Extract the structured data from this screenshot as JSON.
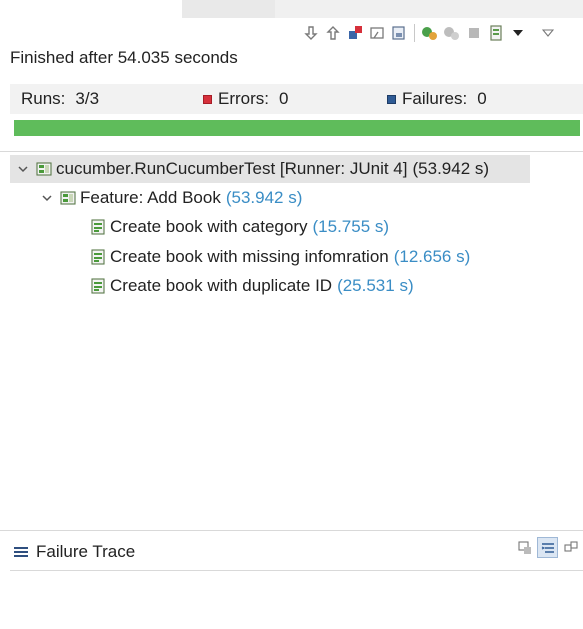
{
  "status": {
    "text": "Finished after 54.035 seconds"
  },
  "counters": {
    "runs_label": "Runs:",
    "runs_value": "3/3",
    "errors_label": "Errors:",
    "errors_value": "0",
    "failures_label": "Failures:",
    "failures_value": "0"
  },
  "progress": {
    "fraction": 1.0,
    "color": "#5fbc5b"
  },
  "toolbar": {
    "icons": [
      "arrow-down-icon",
      "arrow-up-icon",
      "failures-only-icon",
      "ignored-icon",
      "history-icon",
      "rerun-icon",
      "rerun-failed-icon",
      "stop-icon",
      "layout-icon",
      "view-menu-icon",
      "minimize-icon"
    ]
  },
  "tree": {
    "root": {
      "label": "cucumber.RunCucumberTest [Runner: JUnit 4]",
      "time": "(53.942 s)"
    },
    "feature": {
      "label": "Feature: Add Book",
      "time": "(53.942 s)"
    },
    "tests": [
      {
        "label": "Create book with category",
        "time": "(15.755 s)"
      },
      {
        "label": "Create book with missing infomration",
        "time": "(12.656 s)"
      },
      {
        "label": "Create book with duplicate ID",
        "time": "(25.531 s)"
      }
    ]
  },
  "failure_trace": {
    "title": "Failure Trace"
  },
  "colors": {
    "accent_time": "#3a8dc5",
    "error": "#d6303b",
    "failure": "#2f5b95",
    "selection": "#e4e4e4"
  }
}
